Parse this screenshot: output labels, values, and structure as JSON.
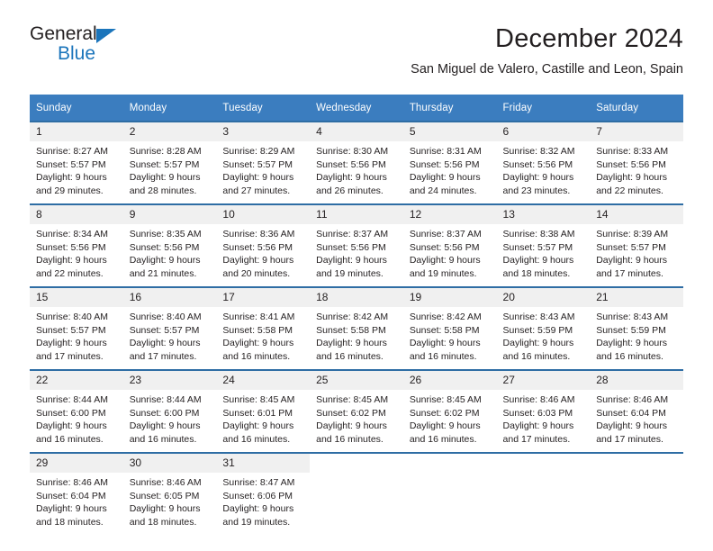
{
  "logo": {
    "text_primary": "General",
    "text_secondary": "Blue",
    "accent_color": "#1b75bb",
    "triangle_icon": "triangle-icon"
  },
  "header": {
    "month_title": "December 2024",
    "location": "San Miguel de Valero, Castille and Leon, Spain"
  },
  "colors": {
    "header_row_background": "#3b7dbf",
    "week_separator": "#2e6da4",
    "daynum_background": "#f0f0f0",
    "text": "#231f20"
  },
  "calendar": {
    "weekday_headers": [
      "Sunday",
      "Monday",
      "Tuesday",
      "Wednesday",
      "Thursday",
      "Friday",
      "Saturday"
    ],
    "weeks": [
      [
        {
          "day": "1",
          "sunrise": "Sunrise: 8:27 AM",
          "sunset": "Sunset: 5:57 PM",
          "daylight_line1": "Daylight: 9 hours",
          "daylight_line2": "and 29 minutes."
        },
        {
          "day": "2",
          "sunrise": "Sunrise: 8:28 AM",
          "sunset": "Sunset: 5:57 PM",
          "daylight_line1": "Daylight: 9 hours",
          "daylight_line2": "and 28 minutes."
        },
        {
          "day": "3",
          "sunrise": "Sunrise: 8:29 AM",
          "sunset": "Sunset: 5:57 PM",
          "daylight_line1": "Daylight: 9 hours",
          "daylight_line2": "and 27 minutes."
        },
        {
          "day": "4",
          "sunrise": "Sunrise: 8:30 AM",
          "sunset": "Sunset: 5:56 PM",
          "daylight_line1": "Daylight: 9 hours",
          "daylight_line2": "and 26 minutes."
        },
        {
          "day": "5",
          "sunrise": "Sunrise: 8:31 AM",
          "sunset": "Sunset: 5:56 PM",
          "daylight_line1": "Daylight: 9 hours",
          "daylight_line2": "and 24 minutes."
        },
        {
          "day": "6",
          "sunrise": "Sunrise: 8:32 AM",
          "sunset": "Sunset: 5:56 PM",
          "daylight_line1": "Daylight: 9 hours",
          "daylight_line2": "and 23 minutes."
        },
        {
          "day": "7",
          "sunrise": "Sunrise: 8:33 AM",
          "sunset": "Sunset: 5:56 PM",
          "daylight_line1": "Daylight: 9 hours",
          "daylight_line2": "and 22 minutes."
        }
      ],
      [
        {
          "day": "8",
          "sunrise": "Sunrise: 8:34 AM",
          "sunset": "Sunset: 5:56 PM",
          "daylight_line1": "Daylight: 9 hours",
          "daylight_line2": "and 22 minutes."
        },
        {
          "day": "9",
          "sunrise": "Sunrise: 8:35 AM",
          "sunset": "Sunset: 5:56 PM",
          "daylight_line1": "Daylight: 9 hours",
          "daylight_line2": "and 21 minutes."
        },
        {
          "day": "10",
          "sunrise": "Sunrise: 8:36 AM",
          "sunset": "Sunset: 5:56 PM",
          "daylight_line1": "Daylight: 9 hours",
          "daylight_line2": "and 20 minutes."
        },
        {
          "day": "11",
          "sunrise": "Sunrise: 8:37 AM",
          "sunset": "Sunset: 5:56 PM",
          "daylight_line1": "Daylight: 9 hours",
          "daylight_line2": "and 19 minutes."
        },
        {
          "day": "12",
          "sunrise": "Sunrise: 8:37 AM",
          "sunset": "Sunset: 5:56 PM",
          "daylight_line1": "Daylight: 9 hours",
          "daylight_line2": "and 19 minutes."
        },
        {
          "day": "13",
          "sunrise": "Sunrise: 8:38 AM",
          "sunset": "Sunset: 5:57 PM",
          "daylight_line1": "Daylight: 9 hours",
          "daylight_line2": "and 18 minutes."
        },
        {
          "day": "14",
          "sunrise": "Sunrise: 8:39 AM",
          "sunset": "Sunset: 5:57 PM",
          "daylight_line1": "Daylight: 9 hours",
          "daylight_line2": "and 17 minutes."
        }
      ],
      [
        {
          "day": "15",
          "sunrise": "Sunrise: 8:40 AM",
          "sunset": "Sunset: 5:57 PM",
          "daylight_line1": "Daylight: 9 hours",
          "daylight_line2": "and 17 minutes."
        },
        {
          "day": "16",
          "sunrise": "Sunrise: 8:40 AM",
          "sunset": "Sunset: 5:57 PM",
          "daylight_line1": "Daylight: 9 hours",
          "daylight_line2": "and 17 minutes."
        },
        {
          "day": "17",
          "sunrise": "Sunrise: 8:41 AM",
          "sunset": "Sunset: 5:58 PM",
          "daylight_line1": "Daylight: 9 hours",
          "daylight_line2": "and 16 minutes."
        },
        {
          "day": "18",
          "sunrise": "Sunrise: 8:42 AM",
          "sunset": "Sunset: 5:58 PM",
          "daylight_line1": "Daylight: 9 hours",
          "daylight_line2": "and 16 minutes."
        },
        {
          "day": "19",
          "sunrise": "Sunrise: 8:42 AM",
          "sunset": "Sunset: 5:58 PM",
          "daylight_line1": "Daylight: 9 hours",
          "daylight_line2": "and 16 minutes."
        },
        {
          "day": "20",
          "sunrise": "Sunrise: 8:43 AM",
          "sunset": "Sunset: 5:59 PM",
          "daylight_line1": "Daylight: 9 hours",
          "daylight_line2": "and 16 minutes."
        },
        {
          "day": "21",
          "sunrise": "Sunrise: 8:43 AM",
          "sunset": "Sunset: 5:59 PM",
          "daylight_line1": "Daylight: 9 hours",
          "daylight_line2": "and 16 minutes."
        }
      ],
      [
        {
          "day": "22",
          "sunrise": "Sunrise: 8:44 AM",
          "sunset": "Sunset: 6:00 PM",
          "daylight_line1": "Daylight: 9 hours",
          "daylight_line2": "and 16 minutes."
        },
        {
          "day": "23",
          "sunrise": "Sunrise: 8:44 AM",
          "sunset": "Sunset: 6:00 PM",
          "daylight_line1": "Daylight: 9 hours",
          "daylight_line2": "and 16 minutes."
        },
        {
          "day": "24",
          "sunrise": "Sunrise: 8:45 AM",
          "sunset": "Sunset: 6:01 PM",
          "daylight_line1": "Daylight: 9 hours",
          "daylight_line2": "and 16 minutes."
        },
        {
          "day": "25",
          "sunrise": "Sunrise: 8:45 AM",
          "sunset": "Sunset: 6:02 PM",
          "daylight_line1": "Daylight: 9 hours",
          "daylight_line2": "and 16 minutes."
        },
        {
          "day": "26",
          "sunrise": "Sunrise: 8:45 AM",
          "sunset": "Sunset: 6:02 PM",
          "daylight_line1": "Daylight: 9 hours",
          "daylight_line2": "and 16 minutes."
        },
        {
          "day": "27",
          "sunrise": "Sunrise: 8:46 AM",
          "sunset": "Sunset: 6:03 PM",
          "daylight_line1": "Daylight: 9 hours",
          "daylight_line2": "and 17 minutes."
        },
        {
          "day": "28",
          "sunrise": "Sunrise: 8:46 AM",
          "sunset": "Sunset: 6:04 PM",
          "daylight_line1": "Daylight: 9 hours",
          "daylight_line2": "and 17 minutes."
        }
      ],
      [
        {
          "day": "29",
          "sunrise": "Sunrise: 8:46 AM",
          "sunset": "Sunset: 6:04 PM",
          "daylight_line1": "Daylight: 9 hours",
          "daylight_line2": "and 18 minutes."
        },
        {
          "day": "30",
          "sunrise": "Sunrise: 8:46 AM",
          "sunset": "Sunset: 6:05 PM",
          "daylight_line1": "Daylight: 9 hours",
          "daylight_line2": "and 18 minutes."
        },
        {
          "day": "31",
          "sunrise": "Sunrise: 8:47 AM",
          "sunset": "Sunset: 6:06 PM",
          "daylight_line1": "Daylight: 9 hours",
          "daylight_line2": "and 19 minutes."
        },
        {
          "day": "",
          "sunrise": "",
          "sunset": "",
          "daylight_line1": "",
          "daylight_line2": ""
        },
        {
          "day": "",
          "sunrise": "",
          "sunset": "",
          "daylight_line1": "",
          "daylight_line2": ""
        },
        {
          "day": "",
          "sunrise": "",
          "sunset": "",
          "daylight_line1": "",
          "daylight_line2": ""
        },
        {
          "day": "",
          "sunrise": "",
          "sunset": "",
          "daylight_line1": "",
          "daylight_line2": ""
        }
      ]
    ]
  }
}
